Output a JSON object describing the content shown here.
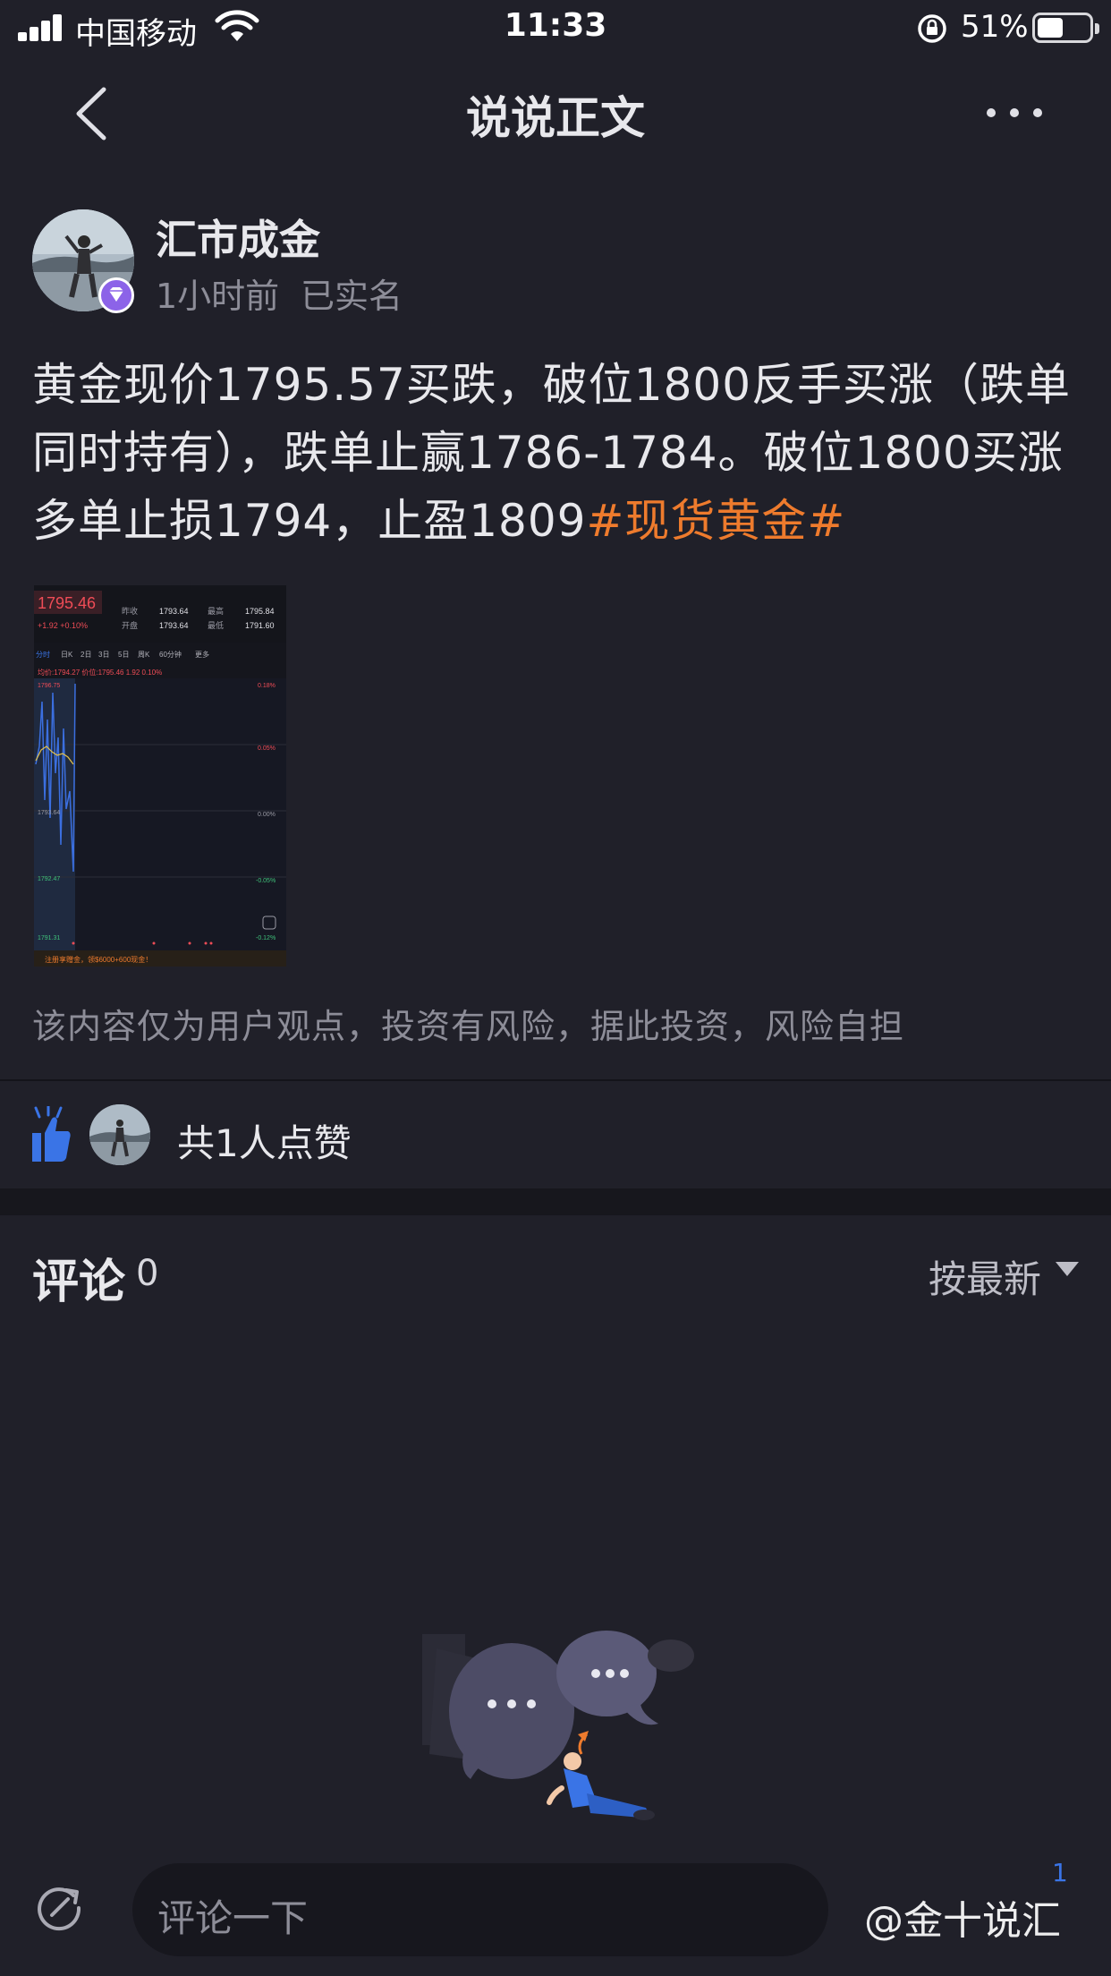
{
  "status_bar": {
    "carrier": "中国移动",
    "time": "11:33",
    "battery": "51%",
    "battery_level": 0.51
  },
  "nav": {
    "title": "说说正文"
  },
  "post": {
    "author": "汇市成金",
    "time": "1小时前",
    "verified": "已实名",
    "text": "黄金现价1795.57买跌，破位1800反手买涨（跌单同时持有），跌单止赢1786-1784。破位1800买涨多单止损1794，止盈1809",
    "hashtag": "#现货黄金#",
    "disclaimer": "该内容仅为用户观点，投资有风险，据此投资，风险自担"
  },
  "chart_image": {
    "price": "1795.46",
    "change": "+1.92  +0.10%",
    "prev_close_label": "昨收",
    "prev_close": "1793.64",
    "high_label": "最高",
    "high": "1795.84",
    "open_label": "开盘",
    "open": "1793.64",
    "low_label": "最低",
    "low": "1791.60",
    "tabs": [
      "分时",
      "日K",
      "2日",
      "3日",
      "5日",
      "周K",
      "60分钟",
      "更多"
    ],
    "avg_line": "均价:1794.27  价位:1795.46  1.92  0.10%",
    "y_labels": [
      "1796.75",
      "1793.64",
      "1792.47",
      "1791.31"
    ],
    "pct_labels": [
      "0.18%",
      "0.05%",
      "0.00%",
      "-0.05%",
      "-0.12%"
    ],
    "banner": "注册享赠金，领$6000+600现金！"
  },
  "likes": {
    "text": "共1人点赞"
  },
  "comments": {
    "title": "评论",
    "count": "0",
    "sort": "按最新"
  },
  "bottom": {
    "placeholder": "评论一下",
    "watermark": "@金十说汇",
    "like_count": "1"
  },
  "colors": {
    "background": "#202029",
    "hashtag": "#ee7b2d",
    "accent_blue": "#3a74e6",
    "badge_purple": "#8c63e8"
  }
}
